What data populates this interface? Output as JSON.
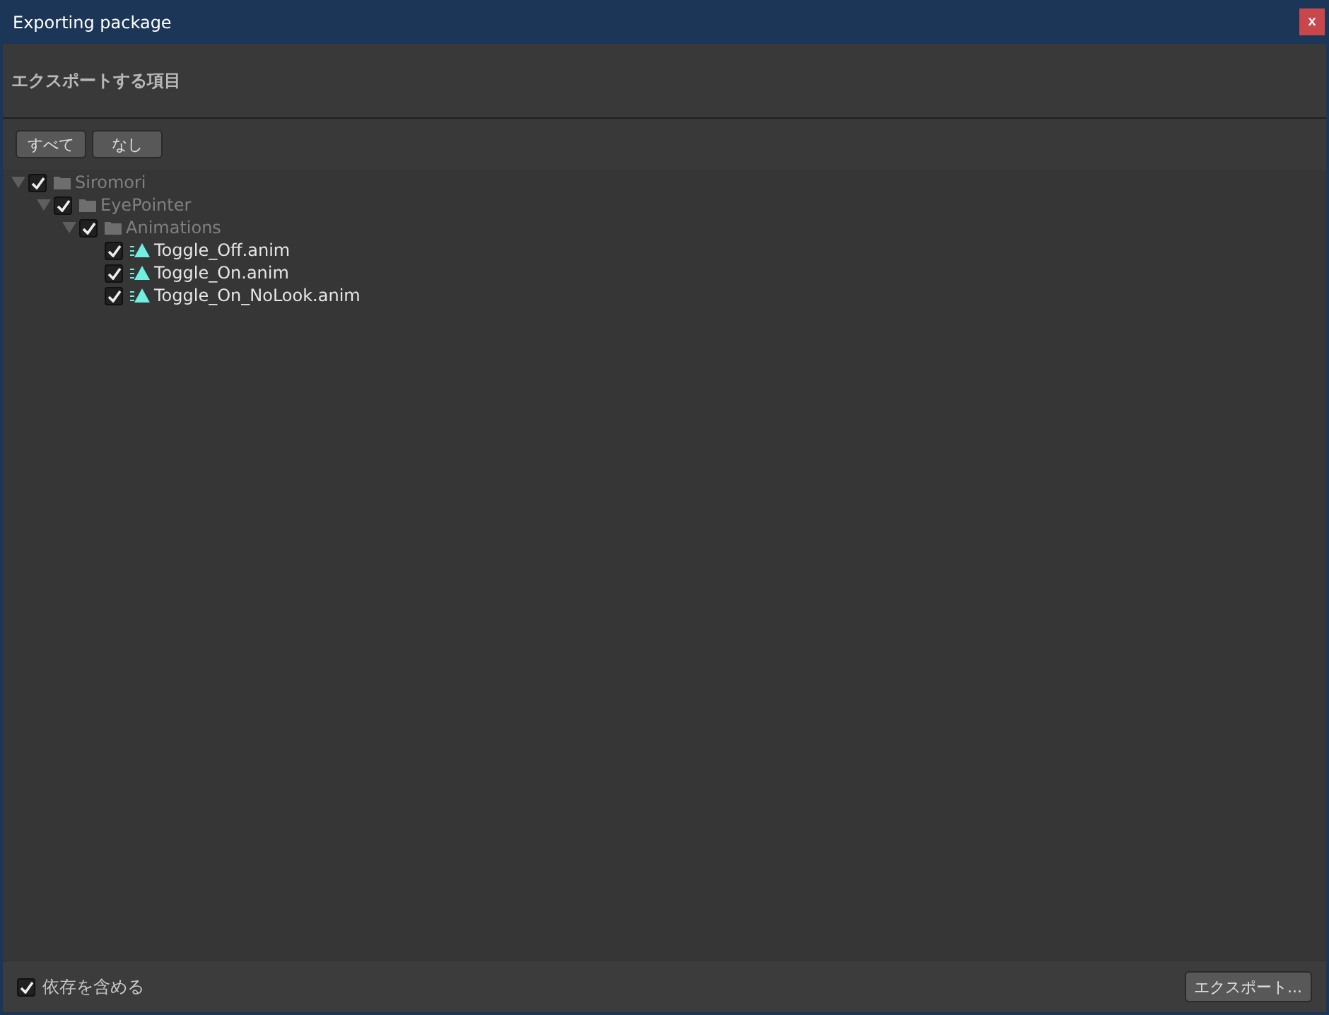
{
  "window": {
    "title": "Exporting package",
    "close_label": "x"
  },
  "header": {
    "title": "エクスポートする項目"
  },
  "toolbar": {
    "buttons": [
      "すべて",
      "なし"
    ]
  },
  "tree": [
    {
      "kind": "folder",
      "label": "Siromori",
      "checked": true,
      "expanded": true,
      "children": [
        {
          "kind": "folder",
          "label": "EyePointer",
          "checked": true,
          "expanded": true,
          "children": [
            {
              "kind": "folder",
              "label": "Animations",
              "checked": true,
              "expanded": true,
              "children": [
                {
                  "kind": "file",
                  "label": "Toggle_Off.anim",
                  "checked": true
                },
                {
                  "kind": "file",
                  "label": "Toggle_On.anim",
                  "checked": true
                },
                {
                  "kind": "file",
                  "label": "Toggle_On_NoLook.anim",
                  "checked": true
                }
              ]
            }
          ]
        }
      ]
    }
  ],
  "footer": {
    "include_dependencies": {
      "label": "依存を含める",
      "checked": true
    },
    "export_button": "エクスポート..."
  }
}
